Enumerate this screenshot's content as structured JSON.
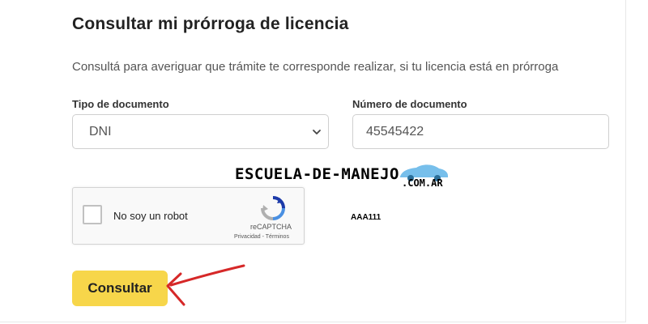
{
  "form": {
    "title": "Consultar mi prórroga de licencia",
    "subtitle": "Consultá para averiguar que trámite te corresponde realizar, si tu licencia está en prórroga",
    "doc_type_label": "Tipo de documento",
    "doc_type_value": "DNI",
    "doc_number_label": "Número de documento",
    "doc_number_value": "45545422",
    "submit_label": "Consultar"
  },
  "recaptcha": {
    "label": "No soy un robot",
    "brand": "reCAPTCHA",
    "links": "Privacidad - Términos",
    "checked": false
  },
  "overlay": {
    "watermark": "ESCUELA-DE-MANEJO",
    "watermark_domain": ".COM.AR",
    "code": "AAA111"
  },
  "colors": {
    "button": "#f7d64a",
    "arrow": "#d62828",
    "recaptcha_blue": "#4a90e2"
  },
  "icons": {
    "select_chevron": "chevron-down-icon",
    "recaptcha_logo": "recaptcha-logo-icon",
    "car": "car-icon",
    "arrow": "hand-drawn-arrow-icon"
  }
}
